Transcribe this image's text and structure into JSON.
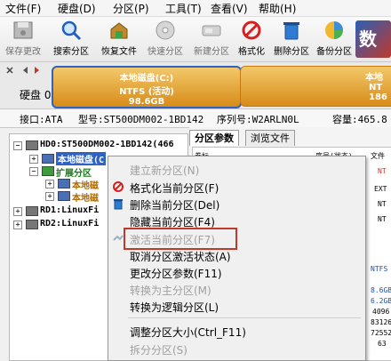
{
  "menu": [
    "文件(F)",
    "硬盘(D)",
    "分区(P)",
    "工具(T)",
    "查看(V)",
    "帮助(H)"
  ],
  "toolbar": [
    {
      "label": "保存更改",
      "icon": "save-icon",
      "enabled": false
    },
    {
      "label": "搜索分区",
      "icon": "search-icon",
      "enabled": true
    },
    {
      "label": "恢复文件",
      "icon": "recover-icon",
      "enabled": true
    },
    {
      "label": "快速分区",
      "icon": "quick-partition-icon",
      "enabled": false
    },
    {
      "label": "新建分区",
      "icon": "new-partition-icon",
      "enabled": false
    },
    {
      "label": "格式化",
      "icon": "format-icon",
      "enabled": true
    },
    {
      "label": "删除分区",
      "icon": "delete-icon",
      "enabled": true
    },
    {
      "label": "备份分区",
      "icon": "backup-icon",
      "enabled": true
    }
  ],
  "disk": {
    "label": "硬盘 0",
    "segments": [
      {
        "name": "本地磁盘(C:)",
        "fs": "NTFS (活动)",
        "size": "98.6GB"
      },
      {
        "name": "本地",
        "fs": "NT",
        "size": "186"
      }
    ]
  },
  "info": {
    "iface": "接口:ATA",
    "model": "型号:ST500DM002-1BD142",
    "serial": "序列号:W2ARLN0L",
    "capacity": "容量:465.8"
  },
  "tree": {
    "disk0": "HD0:ST500DM002-1BD142(466",
    "local_c": "本地磁盘(C",
    "extended": "扩展分区",
    "local_d": "本地磁",
    "local_e": "本地磁",
    "rd1": "RD1:LinuxFi",
    "rd2": "RD2:LinuxFi"
  },
  "tabs": [
    "分区参数",
    "浏览文件"
  ],
  "grid": {
    "headers": [
      "卷标",
      "序号(状态)",
      "文件"
    ],
    "fs_values": [
      "NT",
      "EXT",
      "NT",
      "NT"
    ],
    "right_values": [
      "NTFS",
      "8.6GB",
      "6.2GB",
      "4096",
      "83126",
      "72552",
      "63"
    ]
  },
  "context_menu": [
    {
      "label": "建立新分区(N)",
      "enabled": false,
      "icon": ""
    },
    {
      "label": "格式化当前分区(F)",
      "enabled": true,
      "icon": "format-icon"
    },
    {
      "label": "删除当前分区(Del)",
      "enabled": true,
      "icon": "trash-icon"
    },
    {
      "label": "隐藏当前分区(F4)",
      "enabled": true,
      "icon": ""
    },
    {
      "label": "激活当前分区(F7)",
      "enabled": false,
      "icon": "activate-icon",
      "highlighted": true
    },
    {
      "label": "取消分区激活状态(A)",
      "enabled": true,
      "icon": ""
    },
    {
      "label": "更改分区参数(F11)",
      "enabled": true,
      "icon": ""
    },
    {
      "label": "转换为主分区(M)",
      "enabled": false,
      "icon": ""
    },
    {
      "label": "转换为逻辑分区(L)",
      "enabled": true,
      "icon": ""
    },
    {
      "label": "调整分区大小(Ctrl_F11)",
      "enabled": true,
      "icon": ""
    },
    {
      "label": "拆分分区(S)",
      "enabled": false,
      "icon": ""
    }
  ],
  "colors": {
    "partition_orange": "#d78b19",
    "selection_blue": "#2e62c4",
    "highlight_box": "#c0392b",
    "disabled_text": "#a0a0a0"
  }
}
